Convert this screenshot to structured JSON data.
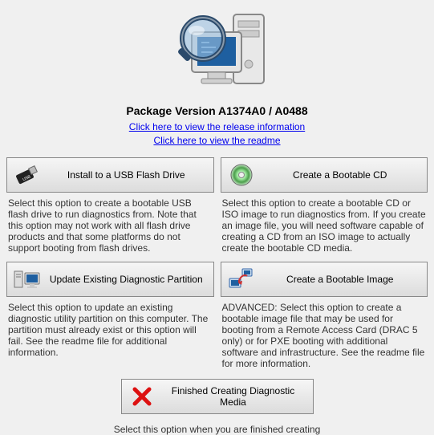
{
  "header": {
    "title": "Package Version A1374A0 / A0488",
    "release_link": "Click here to view the release information",
    "readme_link": "Click here to view the readme"
  },
  "options": {
    "usb": {
      "label": "Install to a USB Flash Drive",
      "desc": "Select this option to create a bootable USB flash drive to run diagnostics from. Note that this option may not work with all flash drive products and that some platforms do not support booting from flash drives."
    },
    "cd": {
      "label": "Create a Bootable CD",
      "desc": "Select this option to create a bootable CD or ISO image to run diagnostics from. If you create an image file, you will need software capable of creating a CD from an ISO image to actually create the bootable CD media."
    },
    "update": {
      "label": "Update Existing Diagnostic Partition",
      "desc": "Select this option to update an existing diagnostic utility partition on this computer. The partition must already exist or this option will fail. See the readme file for additional information."
    },
    "image": {
      "label": "Create a Bootable Image",
      "desc": "ADVANCED: Select this option to create a bootable image file that may be used for booting from a Remote Access Card (DRAC 5 only) or for PXE booting with additional software and infrastructure. See the readme file for more information."
    },
    "finish": {
      "label": "Finished Creating Diagnostic Media",
      "desc": "Select this option when you are finished creating"
    }
  }
}
